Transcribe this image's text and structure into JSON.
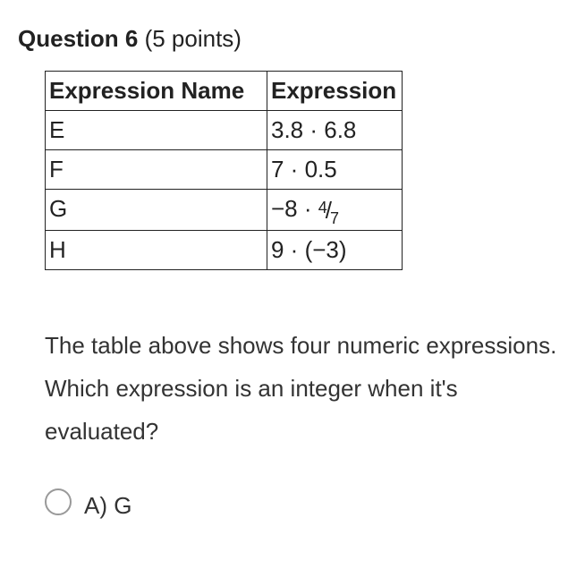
{
  "header": {
    "prefix": "Question 6",
    "points": " (5 points)"
  },
  "table": {
    "headers": [
      "Expression Name",
      "Expression"
    ],
    "rows": [
      {
        "name": "E",
        "expr": "3.8 · 6.8",
        "is_fraction": false
      },
      {
        "name": "F",
        "expr": "7 · 0.5",
        "is_fraction": false
      },
      {
        "name": "G",
        "expr_prefix": "−8 · ",
        "frac_num": "4",
        "frac_den": "7",
        "is_fraction": true
      },
      {
        "name": "H",
        "expr": "9 · (−3)",
        "is_fraction": false
      }
    ]
  },
  "question_text": "The table above shows four numeric expressions. Which expression is an integer when it's evaluated?",
  "options": [
    {
      "label": "A)",
      "value": "G"
    }
  ]
}
